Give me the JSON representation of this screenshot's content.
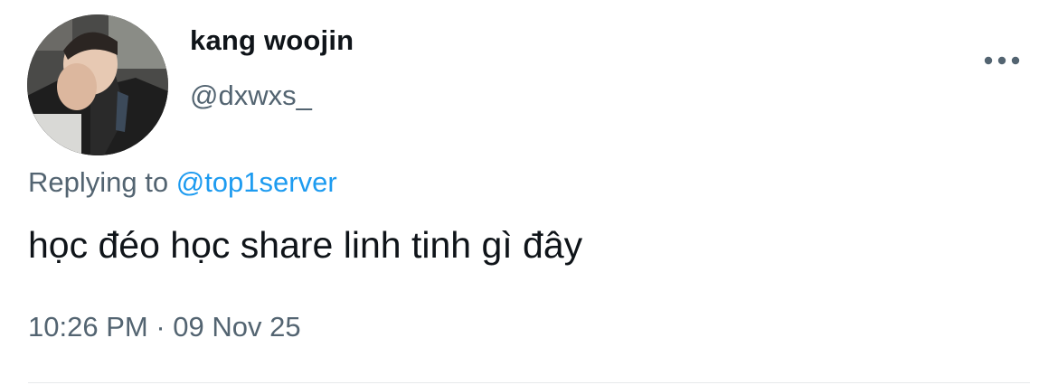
{
  "tweet": {
    "author": {
      "display_name": "kang woojin",
      "handle": "@dxwxs_",
      "avatar_icon": "profile-photo"
    },
    "more_icon": "more-horizontal-icon",
    "reply": {
      "prefix": "Replying to",
      "mention": "@top1server"
    },
    "text": "học đéo học share linh tinh gì đây",
    "time": "10:26 PM",
    "separator": "·",
    "date": "09 Nov 25"
  },
  "colors": {
    "text_primary": "#0f1419",
    "text_secondary": "#536471",
    "accent": "#1d9bf0",
    "divider": "#e6e9eb"
  }
}
